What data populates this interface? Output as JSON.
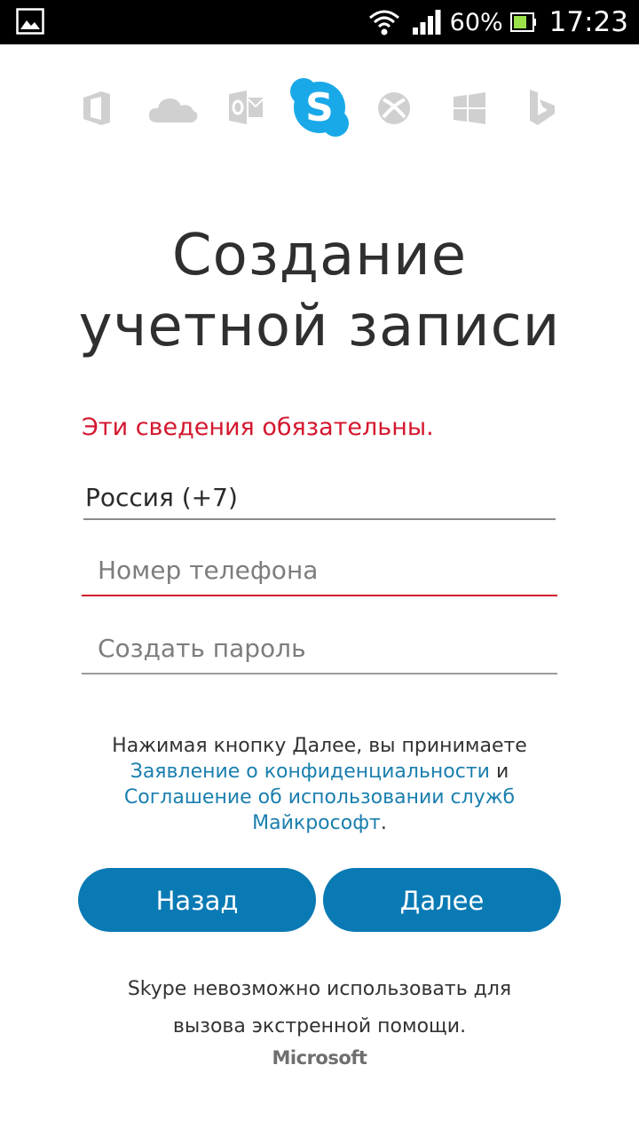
{
  "status_bar": {
    "battery_percent": "60%",
    "time": "17:23",
    "icons": [
      "gallery-icon",
      "wifi-icon",
      "signal-icon",
      "battery-icon"
    ]
  },
  "app_icons": [
    "office-icon",
    "onedrive-icon",
    "outlook-icon",
    "skype-icon",
    "xbox-icon",
    "windows-icon",
    "bing-icon"
  ],
  "page": {
    "title_line1": "Создание",
    "title_line2": "учетной записи",
    "required_notice": "Эти сведения обязательны."
  },
  "form": {
    "country_value": "Россия (+7)",
    "phone_placeholder": "Номер телефона",
    "password_placeholder": "Создать пароль"
  },
  "terms": {
    "prefix": "Нажимая кнопку Далее, вы принимаете",
    "privacy_link": "Заявление о конфиденциальности",
    "conjunction": " и",
    "services_link_line1": "Соглашение об использовании служб",
    "services_link_line2": "Майкрософт",
    "suffix": "."
  },
  "buttons": {
    "back": "Назад",
    "next": "Далее"
  },
  "footer": {
    "emergency_line1": "Skype невозможно использовать для",
    "emergency_line2": "вызова экстренной помощи.",
    "brand": "Microsoft"
  },
  "colors": {
    "accent_blue": "#0a7ab4",
    "link_blue": "#1a7fae",
    "error_red": "#d4172e",
    "skype_blue": "#1aa9e8",
    "icon_gray": "#cfcfcf"
  }
}
